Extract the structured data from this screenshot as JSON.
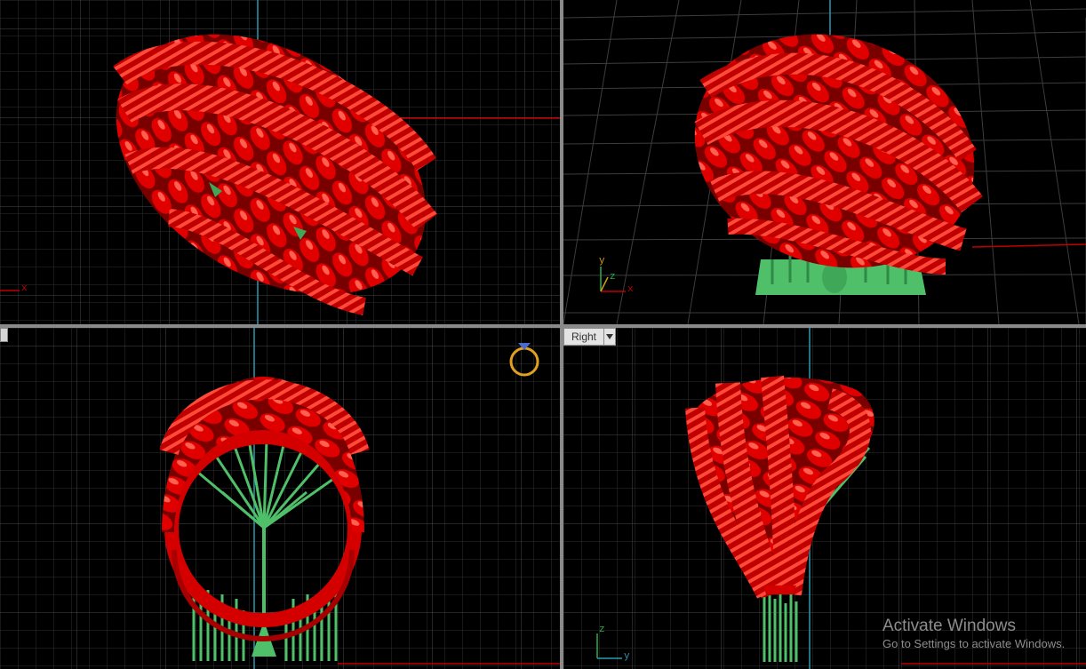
{
  "viewports": {
    "top": {
      "axis_x_label": "x"
    },
    "perspective": {
      "axis_x_label": "x",
      "axis_y_label": "y",
      "axis_z_label": "z"
    },
    "front": {},
    "right": {
      "title": "Right",
      "axis_y_label": "y",
      "axis_z_label": "z"
    }
  },
  "watermark": {
    "title": "Activate Windows",
    "subtitle": "Go to Settings to activate Windows."
  },
  "colors": {
    "background": "#000000",
    "grid_minor": "#2f2f2f",
    "grid_major": "#4a4a4a",
    "model_red": "#d40000",
    "support_green": "#4fbf6a",
    "axis_red": "#c00000",
    "axis_cyan": "#2a9ab0",
    "ring_icon": "#e0a020"
  },
  "icons": [
    "ring-view-icon",
    "viewport-menu-arrow-icon"
  ]
}
